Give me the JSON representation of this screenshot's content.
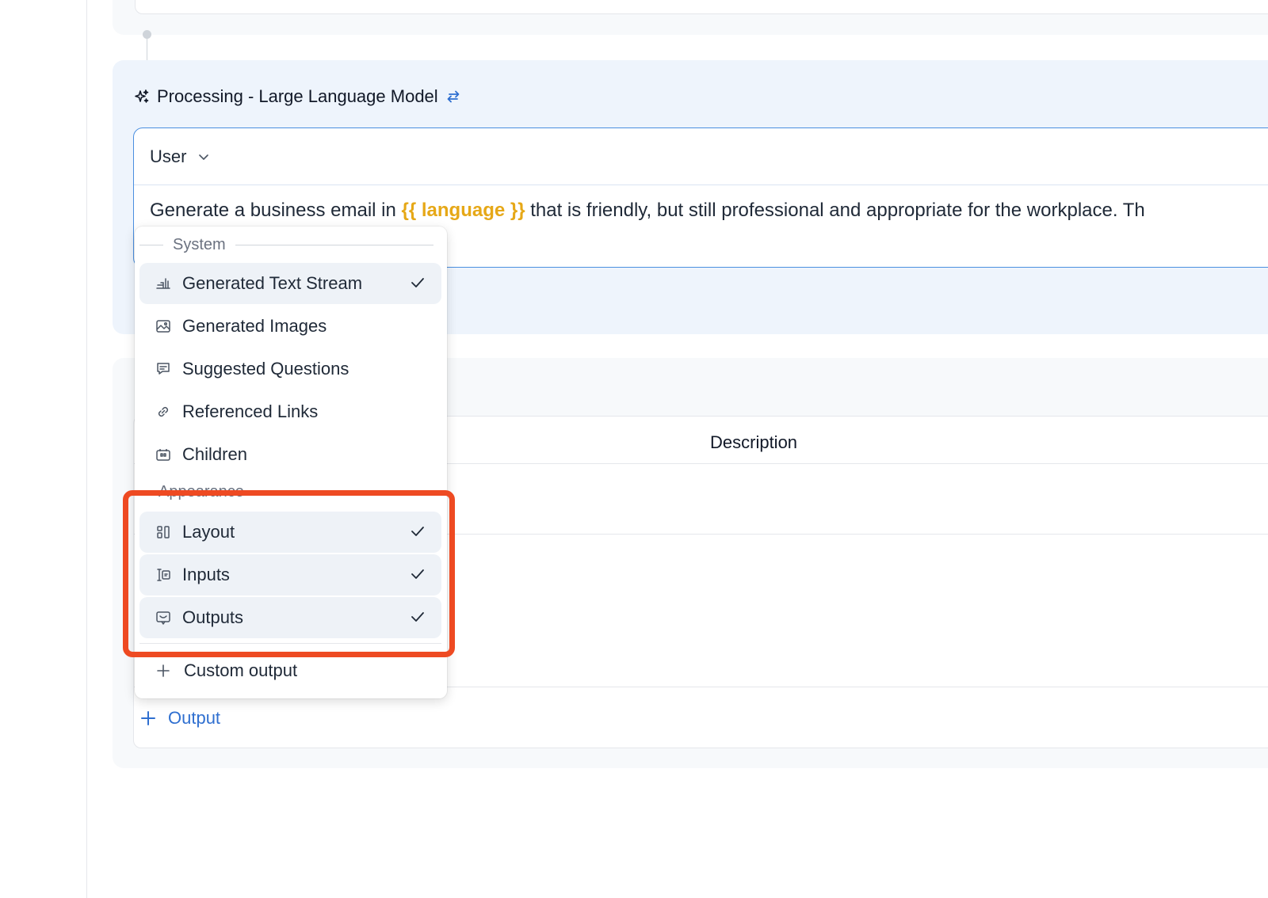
{
  "llm_block": {
    "title": "Processing - Large Language Model",
    "role": "User",
    "prompt": {
      "before": "Generate a business email in ",
      "variable": "{{ language }}",
      "after": " that is friendly, but still professional and appropriate for the workplace. Th"
    }
  },
  "outputs_table": {
    "column_description": "Description",
    "add_output_label": "Output"
  },
  "dropdown": {
    "system_group_label": "System",
    "system_items": [
      {
        "label": "Generated Text Stream",
        "icon": "text-stream-icon",
        "selected": true
      },
      {
        "label": "Generated Images",
        "icon": "image-icon",
        "selected": false
      },
      {
        "label": "Suggested Questions",
        "icon": "chat-question-icon",
        "selected": false
      },
      {
        "label": "Referenced Links",
        "icon": "link-icon",
        "selected": false
      },
      {
        "label": "Children",
        "icon": "children-icon",
        "selected": false
      }
    ],
    "appearance_group_label": "Appearance",
    "appearance_items": [
      {
        "label": "Layout",
        "icon": "layout-icon",
        "selected": true
      },
      {
        "label": "Inputs",
        "icon": "inputs-icon",
        "selected": true
      },
      {
        "label": "Outputs",
        "icon": "outputs-icon",
        "selected": true
      }
    ],
    "custom_output_label": "Custom output"
  },
  "colors": {
    "accent": "#2f6fd0",
    "variable": "#e6a817",
    "highlight": "#ee4a22"
  }
}
